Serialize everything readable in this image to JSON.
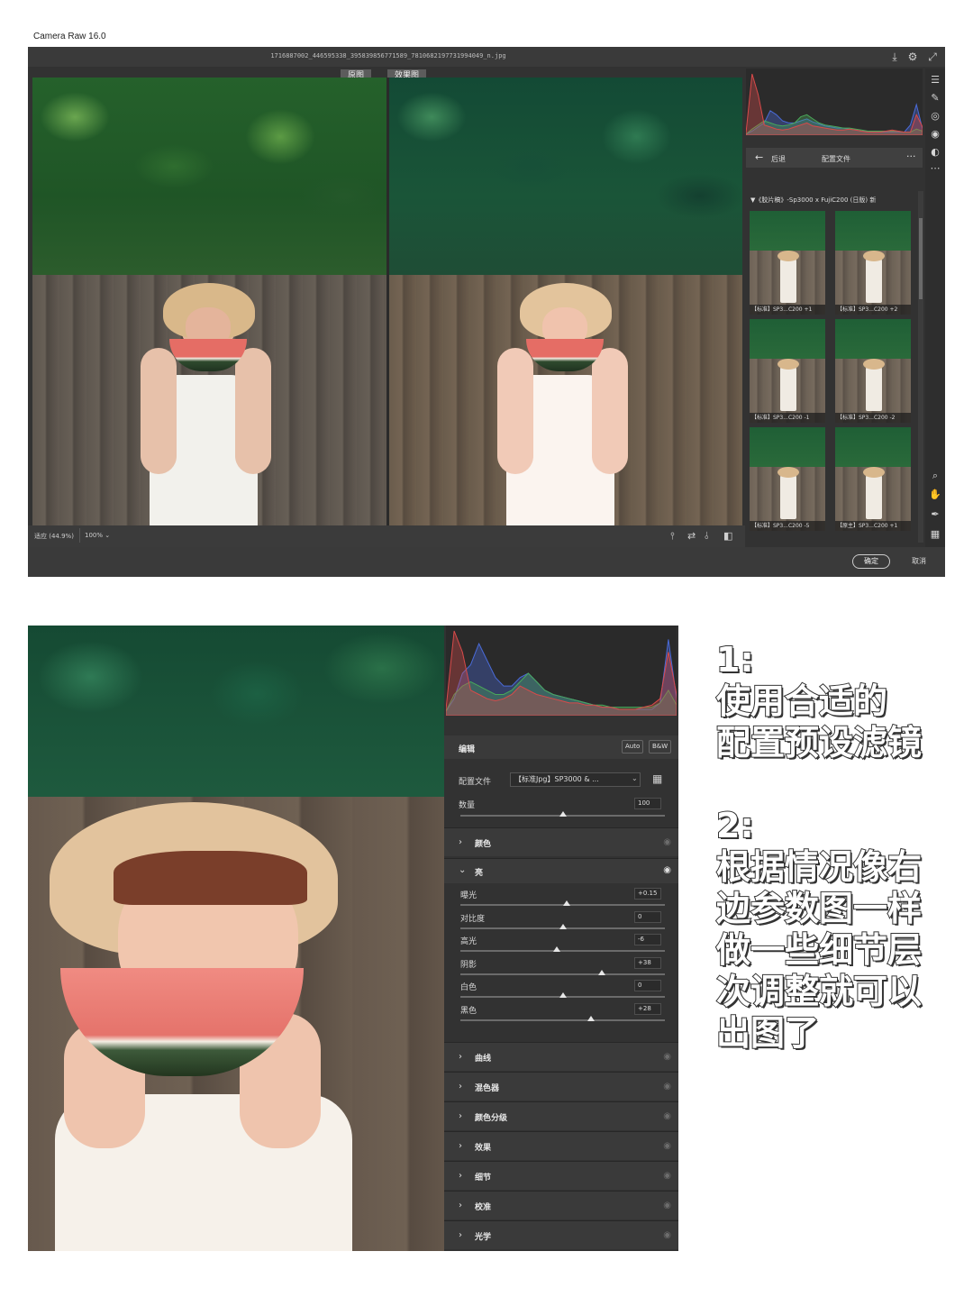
{
  "app": {
    "title": "Camera Raw 16.0"
  },
  "window": {
    "file_name": "1716887002_446595338_395839856771589_7810682197731994049_n.jpg",
    "before_label": "原图",
    "after_label": "效果图",
    "fit_label": "适应 (44.9%)",
    "zoom_value": "100%",
    "ok_label": "确定",
    "cancel_label": "取消",
    "histogram": {
      "red": [
        2,
        60,
        40,
        10,
        8,
        6,
        5,
        6,
        8,
        10,
        12,
        9,
        8,
        7,
        6,
        5,
        5,
        6,
        5,
        4,
        3,
        3,
        3,
        4,
        5,
        4,
        3,
        3,
        20,
        8
      ],
      "green": [
        1,
        6,
        10,
        14,
        12,
        10,
        9,
        10,
        12,
        18,
        20,
        16,
        12,
        10,
        9,
        8,
        7,
        7,
        6,
        5,
        4,
        4,
        4,
        4,
        4,
        4,
        3,
        3,
        6,
        4
      ],
      "blue": [
        1,
        4,
        8,
        12,
        24,
        20,
        14,
        12,
        12,
        14,
        16,
        13,
        11,
        9,
        8,
        7,
        7,
        6,
        5,
        4,
        4,
        3,
        3,
        3,
        3,
        3,
        3,
        10,
        30,
        6
      ]
    }
  },
  "profiles_panel": {
    "back_label": "后退",
    "title": "配置文件",
    "more": "···",
    "group": "▼《胶片稿》-Sp3000 x FujiC200 (日版) 新",
    "thumbs": [
      "【标准】SP3...C200 +1",
      "【标准】SP3...C200 +2",
      "【标准】SP3...C200 -1",
      "【标准】SP3...C200 -2",
      "【标准】SP3...C200 -5",
      "【原主】SP3...C200 +1"
    ]
  },
  "edit_panel": {
    "title": "编辑",
    "auto_label": "Auto",
    "bw_label": "B&W",
    "profile_label": "配置文件",
    "profile_value": "【标准Jpg】SP3000 & ...",
    "amount_label": "数量",
    "amount_value": "100",
    "color_section": "颜色",
    "light_section": "亮",
    "light_sliders": [
      {
        "label": "曝光",
        "value": "+0.15",
        "level": 0.52
      },
      {
        "label": "对比度",
        "value": "0",
        "level": 0.5
      },
      {
        "label": "高光",
        "value": "-6",
        "level": 0.47
      },
      {
        "label": "阴影",
        "value": "+38",
        "level": 0.69
      },
      {
        "label": "白色",
        "value": "0",
        "level": 0.5
      },
      {
        "label": "黑色",
        "value": "+28",
        "level": 0.64
      }
    ],
    "amount_level": 0.5,
    "collapsed_sections": [
      "曲线",
      "混色器",
      "颜色分级",
      "效果",
      "细节",
      "校准",
      "光学"
    ],
    "histogram": {
      "red": [
        3,
        40,
        30,
        12,
        10,
        8,
        7,
        8,
        10,
        14,
        12,
        10,
        9,
        8,
        7,
        6,
        6,
        5,
        5,
        4,
        4,
        3,
        3,
        3,
        4,
        5,
        8,
        30,
        10
      ],
      "green": [
        2,
        10,
        14,
        16,
        14,
        12,
        10,
        10,
        12,
        16,
        20,
        16,
        12,
        10,
        9,
        8,
        7,
        6,
        5,
        5,
        4,
        4,
        4,
        4,
        4,
        4,
        6,
        12,
        5
      ],
      "blue": [
        2,
        8,
        20,
        24,
        34,
        26,
        18,
        14,
        14,
        18,
        20,
        16,
        12,
        10,
        9,
        8,
        7,
        6,
        5,
        4,
        4,
        3,
        3,
        3,
        3,
        3,
        6,
        36,
        8
      ]
    }
  },
  "notes": {
    "n1_num": "1:",
    "n1_line1": "使用合适的",
    "n1_line2": "配置预设滤镜",
    "n2_num": "2:",
    "n2_line1": "根据情况像右",
    "n2_line2": "边参数图一样",
    "n2_line3": "做一些细节层",
    "n2_line4": "次调整就可以",
    "n2_line5": "出图了"
  },
  "colors": {
    "panel_bg": "#323232",
    "section_bg": "#3a3a3a",
    "hist_red": "#d94a4a",
    "hist_green": "#4aa85a",
    "hist_blue": "#4a6bd9"
  }
}
